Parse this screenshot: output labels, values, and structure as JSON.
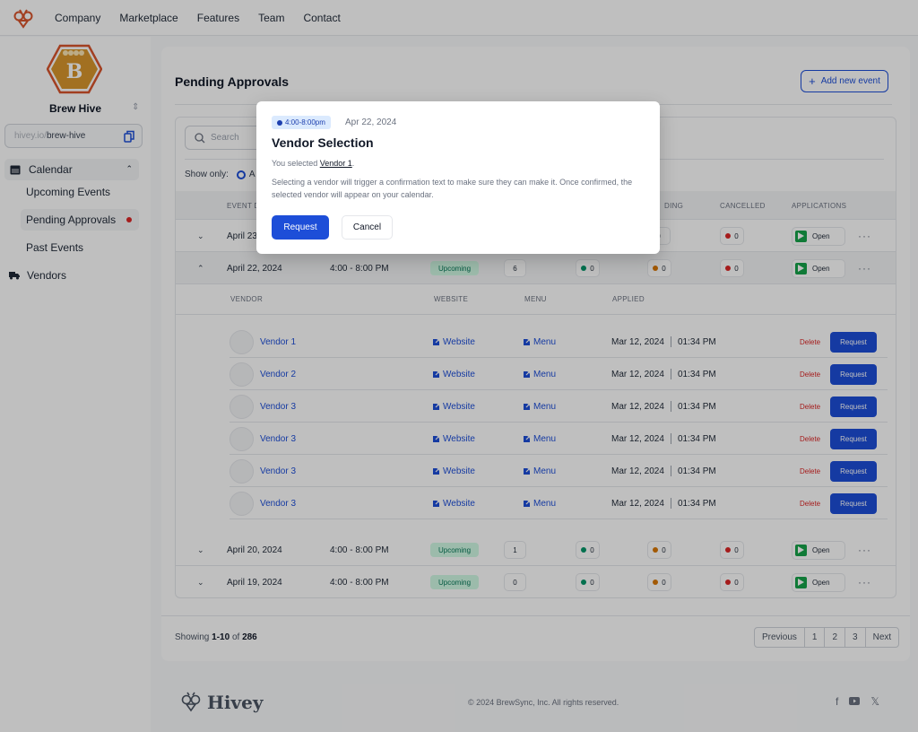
{
  "topnav": {
    "links": [
      "Company",
      "Marketplace",
      "Features",
      "Team",
      "Contact"
    ]
  },
  "sidebar": {
    "brand_initial": "B",
    "brand_name": "Brew Hive",
    "url_prefix": "hivey.io/",
    "url_slug": "brew-hive",
    "calendar_label": "Calendar",
    "sub_items": [
      "Upcoming Events",
      "Pending Approvals",
      "Past Events"
    ],
    "vendors_label": "Vendors"
  },
  "main": {
    "title": "Pending Approvals",
    "add_button": "Add new event",
    "search_placeholder": "Search",
    "show_only_label": "Show only:",
    "show_only_option": "A",
    "columns": {
      "event_date": "EVENT D",
      "pending": "DING",
      "cancelled": "CANCELLED",
      "applications": "APPLICATIONS"
    },
    "events": [
      {
        "date": "April 23",
        "time": "",
        "status": "",
        "count": "",
        "accepted": "",
        "pending": "0",
        "cancelled": "0",
        "app": "Open"
      },
      {
        "date": "April 22, 2024",
        "time": "4:00 - 8:00 PM",
        "status": "Upcoming",
        "count": "6",
        "accepted": "0",
        "pending": "0",
        "cancelled": "0",
        "app": "Open"
      },
      {
        "date": "April 20, 2024",
        "time": "4:00 - 8:00 PM",
        "status": "Upcoming",
        "count": "1",
        "accepted": "0",
        "pending": "0",
        "cancelled": "0",
        "app": "Open"
      },
      {
        "date": "April 19, 2024",
        "time": "4:00 - 8:00 PM",
        "status": "Upcoming",
        "count": "0",
        "accepted": "0",
        "pending": "0",
        "cancelled": "0",
        "app": "Open"
      }
    ],
    "vendor_columns": {
      "vendor": "VENDOR",
      "website": "WEBSITE",
      "menu": "MENU",
      "applied": "APPLIED"
    },
    "vendors": [
      {
        "name": "Vendor 1",
        "website": "Website",
        "menu": "Menu",
        "date": "Mar 12, 2024",
        "time": "01:34 PM",
        "delete": "Delete",
        "request": "Request"
      },
      {
        "name": "Vendor 2",
        "website": "Website",
        "menu": "Menu",
        "date": "Mar 12, 2024",
        "time": "01:34 PM",
        "delete": "Delete",
        "request": "Request"
      },
      {
        "name": "Vendor 3",
        "website": "Website",
        "menu": "Menu",
        "date": "Mar 12, 2024",
        "time": "01:34 PM",
        "delete": "Delete",
        "request": "Request"
      },
      {
        "name": "Vendor 3",
        "website": "Website",
        "menu": "Menu",
        "date": "Mar 12, 2024",
        "time": "01:34 PM",
        "delete": "Delete",
        "request": "Request"
      },
      {
        "name": "Vendor 3",
        "website": "Website",
        "menu": "Menu",
        "date": "Mar 12, 2024",
        "time": "01:34 PM",
        "delete": "Delete",
        "request": "Request"
      },
      {
        "name": "Vendor 3",
        "website": "Website",
        "menu": "Menu",
        "date": "Mar 12, 2024",
        "time": "01:34 PM",
        "delete": "Delete",
        "request": "Request"
      }
    ],
    "pagination": {
      "showing_prefix": "Showing",
      "range": "1-10",
      "of": "of",
      "total": "286",
      "previous": "Previous",
      "pages": [
        "1",
        "2",
        "3"
      ],
      "next": "Next"
    }
  },
  "footer": {
    "logo_text": "Hivey",
    "copyright": "© 2024 BrewSync, Inc. All rights reserved.",
    "socials": [
      "facebook-icon",
      "youtube-icon",
      "x-icon"
    ]
  },
  "modal": {
    "time": "4:00-8:00pm",
    "date": "Apr 22, 2024",
    "title": "Vendor Selection",
    "selected_prefix": "You selected",
    "selected_vendor": "Vendor 1",
    "description": "Selecting a vendor will trigger a confirmation text to make sure they can make it. Once confirmed, the selected vendor will appear on your calendar.",
    "request_label": "Request",
    "cancel_label": "Cancel"
  },
  "colors": {
    "accent": "#1d4ed8",
    "brand_orange": "#d9542c",
    "upcoming_bg": "#d1fae5",
    "upcoming_text": "#047857",
    "danger": "#dc2626",
    "accepted": "#059669",
    "pending": "#d97706"
  }
}
